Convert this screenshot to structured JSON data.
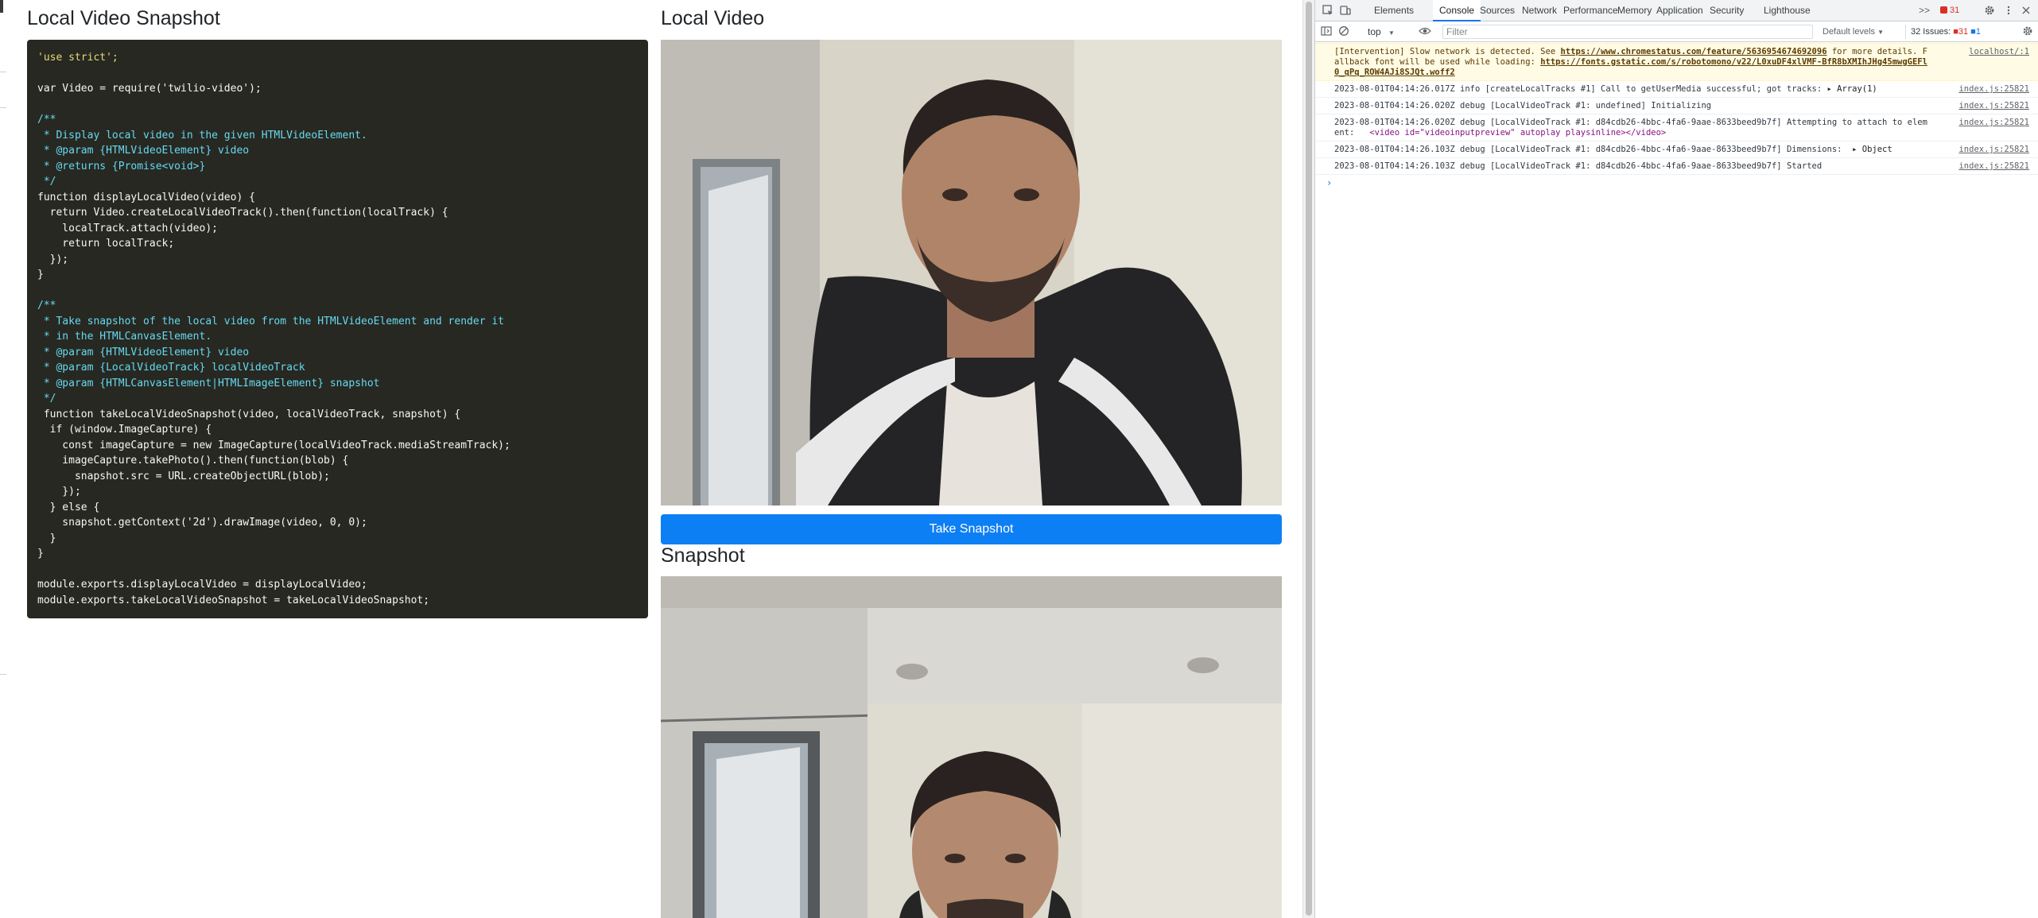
{
  "page": {
    "code_title": "Local Video Snapshot",
    "video_title": "Local Video",
    "snapshot_title": "Snapshot",
    "snapshot_button": "Take Snapshot"
  },
  "code_lines": [
    "'use strict';",
    "",
    "var Video = require('twilio-video');",
    "",
    "/**",
    " * Display local video in the given HTMLVideoElement.",
    " * @param {HTMLVideoElement} video",
    " * @returns {Promise<void>}",
    " */",
    "function displayLocalVideo(video) {",
    "  return Video.createLocalVideoTrack().then(function(localTrack) {",
    "    localTrack.attach(video);",
    "    return localTrack;",
    "  });",
    "}",
    "",
    "/**",
    " * Take snapshot of the local video from the HTMLVideoElement and render it",
    " * in the HTMLCanvasElement.",
    " * @param {HTMLVideoElement} video",
    " * @param {LocalVideoTrack} localVideoTrack",
    " * @param {HTMLCanvasElement|HTMLImageElement} snapshot",
    " */",
    " function takeLocalVideoSnapshot(video, localVideoTrack, snapshot) {",
    "  if (window.ImageCapture) {",
    "    const imageCapture = new ImageCapture(localVideoTrack.mediaStreamTrack);",
    "    imageCapture.takePhoto().then(function(blob) {",
    "      snapshot.src = URL.createObjectURL(blob);",
    "    });",
    "  } else {",
    "    snapshot.getContext('2d').drawImage(video, 0, 0);",
    "  }",
    "}",
    "",
    "module.exports.displayLocalVideo = displayLocalVideo;",
    "module.exports.takeLocalVideoSnapshot = takeLocalVideoSnapshot;"
  ],
  "devtools": {
    "tabs": [
      "Elements",
      "Console",
      "Sources",
      "Network",
      "Performance",
      "Memory",
      "Application",
      "Security",
      "Lighthouse"
    ],
    "active_tab": "Console",
    "more_tabs": ">>",
    "error_count": "31",
    "context": "top",
    "filter_placeholder": "Filter",
    "levels": "Default levels",
    "issues_label": "32 Issues:",
    "issues_errors": "31",
    "issues_info": "1",
    "messages": [
      {
        "level": "warn",
        "text_a": "[Intervention] Slow network is detected. See ",
        "link_a": "https://www.chromestatus.com/feature/5636954674692096",
        "text_b": " for more details. Fallback font will be used while loading: ",
        "link_b": "https://fonts.gstatic.com/s/robotomono/v22/L0xuDF4xlVMF-BfR8bXMIhJHg45mwgGEFl0_qPq_ROW4AJi8SJQt.woff2",
        "source": "localhost/:1"
      },
      {
        "level": "info",
        "text": "2023-08-01T04:14:26.017Z info [createLocalTracks #1] Call to getUserMedia successful; got tracks: ",
        "obj": "▸ Array(1)",
        "source": "index.js:25821"
      },
      {
        "level": "info",
        "text": "2023-08-01T04:14:26.020Z debug [LocalVideoTrack #1: undefined] Initializing",
        "source": "index.js:25821"
      },
      {
        "level": "info",
        "text": "2023-08-01T04:14:26.020Z debug [LocalVideoTrack #1: d84cdb26-4bbc-4fa6-9aae-8633beed9b7f] Attempting to attach to element:   ",
        "html": "<video id=\"videoinputpreview\" autoplay playsinline></video>",
        "source": "index.js:25821"
      },
      {
        "level": "info",
        "text": "2023-08-01T04:14:26.103Z debug [LocalVideoTrack #1: d84cdb26-4bbc-4fa6-9aae-8633beed9b7f] Dimensions:  ",
        "obj": "▸ Object",
        "source": "index.js:25821"
      },
      {
        "level": "info",
        "text": "2023-08-01T04:14:26.103Z debug [LocalVideoTrack #1: d84cdb26-4bbc-4fa6-9aae-8633beed9b7f] Started",
        "source": "index.js:25821"
      }
    ],
    "prompt": "›"
  },
  "colors": {
    "accent": "#0d7ff5",
    "code_bg": "#272822",
    "warn_bg": "#fffbe5",
    "error": "#d93025",
    "devtools_blue": "#1a73e8"
  },
  "icons": {
    "inspect": "inspect-element-icon",
    "device": "device-toolbar-icon",
    "sidebar": "sidebar-toggle-icon",
    "clear": "clear-console-icon",
    "eye": "live-expression-icon",
    "gear": "settings-gear-icon",
    "kebab": "more-options-icon",
    "close": "close-icon"
  }
}
